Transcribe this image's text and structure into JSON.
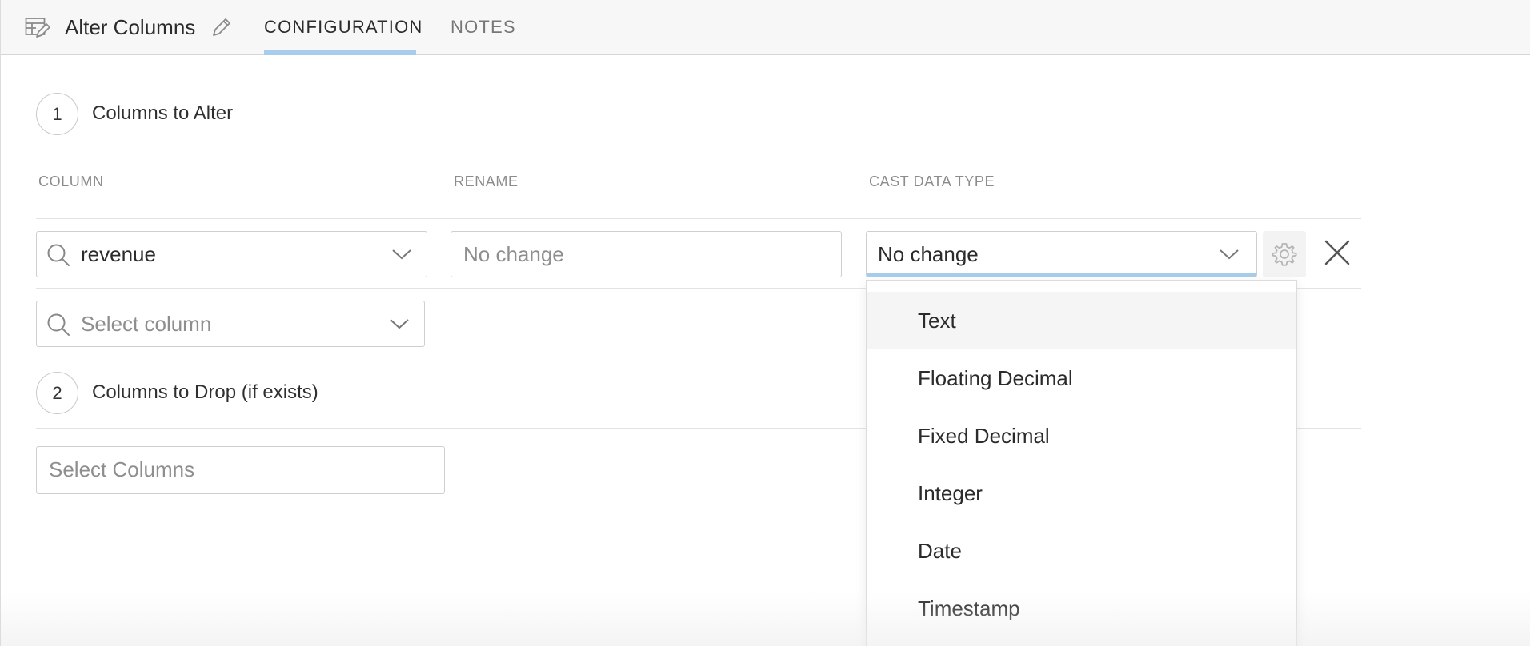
{
  "header": {
    "title": "Alter Columns",
    "tabs": [
      {
        "label": "CONFIGURATION",
        "active": true
      },
      {
        "label": "NOTES",
        "active": false
      }
    ]
  },
  "steps": [
    {
      "number": "1",
      "label": "Columns to Alter"
    },
    {
      "number": "2",
      "label": "Columns to Drop (if exists)"
    }
  ],
  "columns_table": {
    "headers": [
      "COLUMN",
      "RENAME",
      "CAST DATA TYPE"
    ],
    "row": {
      "column_value": "revenue",
      "rename_placeholder": "No change",
      "cast_value": "No change"
    },
    "new_row_placeholder": "Select column"
  },
  "drop": {
    "placeholder": "Select Columns"
  },
  "cast_dropdown": {
    "options": [
      "Text",
      "Floating Decimal",
      "Fixed Decimal",
      "Integer",
      "Date",
      "Timestamp"
    ],
    "hovered_index": 0
  },
  "colors": {
    "accent": "#a8cdec",
    "header_bg": "#f7f7f7",
    "muted_text": "#8c8c8c"
  },
  "icons": [
    "table-edit-icon",
    "pencil-icon",
    "search-icon",
    "chevron-down-icon",
    "gear-icon",
    "close-icon"
  ]
}
